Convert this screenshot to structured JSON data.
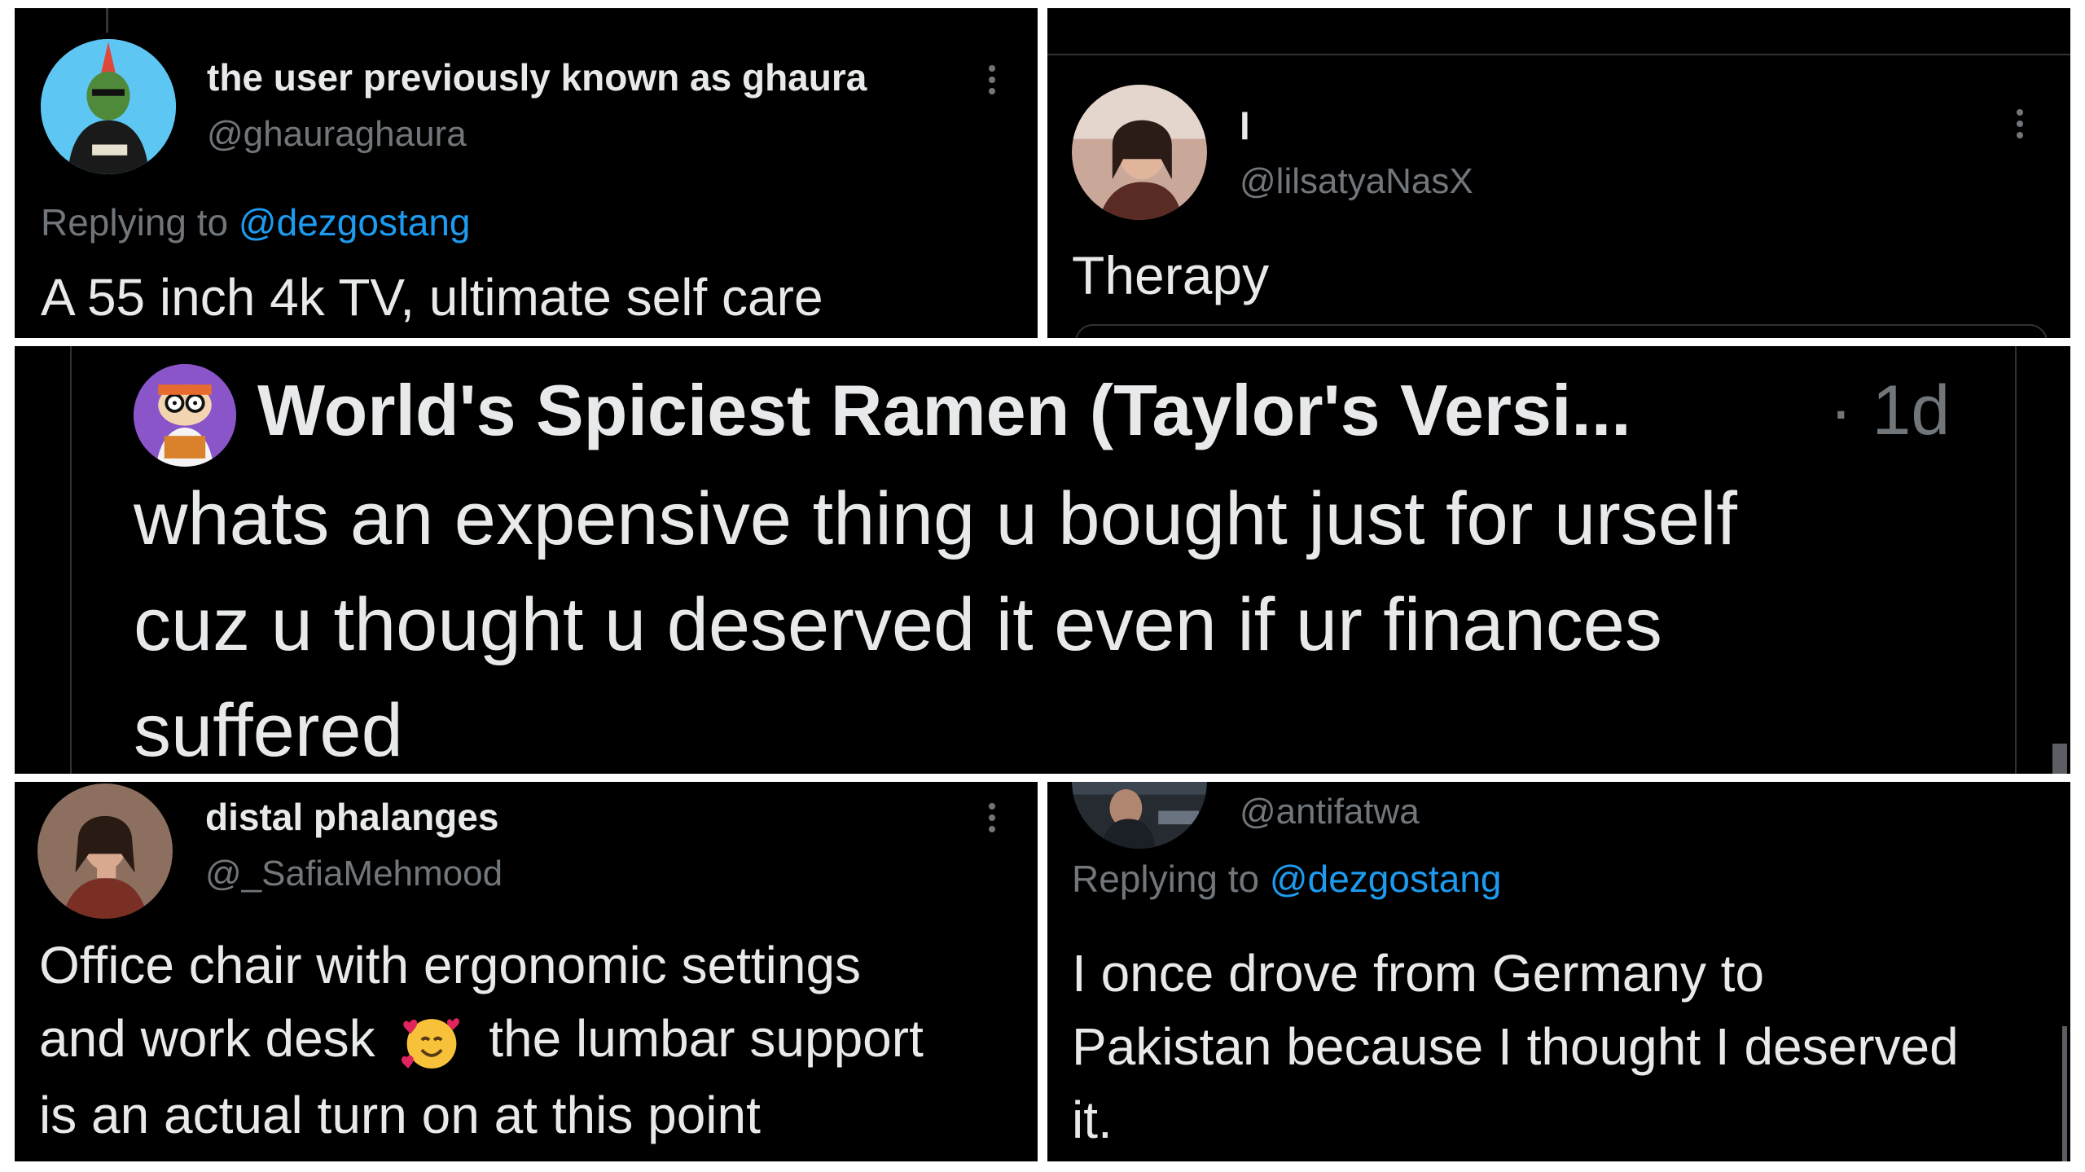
{
  "tweets": {
    "top_left": {
      "display_name": "the user previously known as ghaura",
      "handle": "@ghauraghaura",
      "replying_prefix": "Replying to",
      "replying_to": "@dezgostang",
      "text": "A 55 inch 4k TV, ultimate self care"
    },
    "top_right": {
      "display_name": "l",
      "handle": "@lilsatyaNasX",
      "text": "Therapy"
    },
    "center": {
      "display_name": "World's Spiciest Ramen (Taylor's Versi...",
      "time": "· 1d",
      "text_lines": [
        "whats an expensive thing u bought just for urself",
        "cuz u thought u deserved it even if ur finances",
        "suffered"
      ]
    },
    "bottom_left": {
      "display_name": "distal phalanges",
      "handle": "@_SafiaMehmood",
      "text_lines": [
        "Office chair with ergonomic settings",
        "and work desk",
        "the lumbar support",
        "is an actual turn on at this point"
      ],
      "emoji": "smiling-face-with-hearts-icon"
    },
    "bottom_right": {
      "handle": "@antifatwa",
      "replying_prefix": "Replying to",
      "replying_to": "@dezgostang",
      "text_lines": [
        "I once drove from Germany to",
        "Pakistan because I thought I deserved",
        "it."
      ]
    }
  },
  "colors": {
    "background": "#000000",
    "text": "#e7e9ea",
    "muted": "#71767b",
    "link": "#1d9bf0",
    "divider": "#ffffff"
  }
}
